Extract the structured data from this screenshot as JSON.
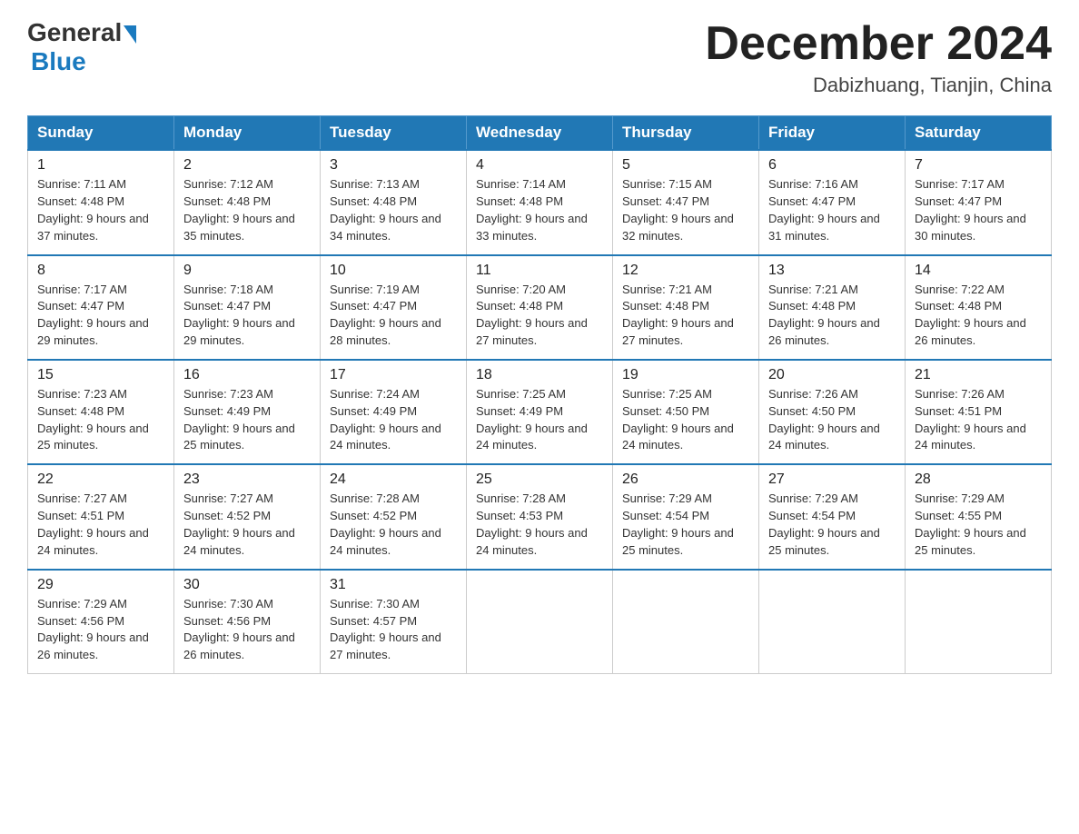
{
  "header": {
    "logo_general": "General",
    "logo_blue": "Blue",
    "month_title": "December 2024",
    "location": "Dabizhuang, Tianjin, China"
  },
  "weekdays": [
    "Sunday",
    "Monday",
    "Tuesday",
    "Wednesday",
    "Thursday",
    "Friday",
    "Saturday"
  ],
  "weeks": [
    [
      {
        "day": "1",
        "sunrise": "Sunrise: 7:11 AM",
        "sunset": "Sunset: 4:48 PM",
        "daylight": "Daylight: 9 hours and 37 minutes."
      },
      {
        "day": "2",
        "sunrise": "Sunrise: 7:12 AM",
        "sunset": "Sunset: 4:48 PM",
        "daylight": "Daylight: 9 hours and 35 minutes."
      },
      {
        "day": "3",
        "sunrise": "Sunrise: 7:13 AM",
        "sunset": "Sunset: 4:48 PM",
        "daylight": "Daylight: 9 hours and 34 minutes."
      },
      {
        "day": "4",
        "sunrise": "Sunrise: 7:14 AM",
        "sunset": "Sunset: 4:48 PM",
        "daylight": "Daylight: 9 hours and 33 minutes."
      },
      {
        "day": "5",
        "sunrise": "Sunrise: 7:15 AM",
        "sunset": "Sunset: 4:47 PM",
        "daylight": "Daylight: 9 hours and 32 minutes."
      },
      {
        "day": "6",
        "sunrise": "Sunrise: 7:16 AM",
        "sunset": "Sunset: 4:47 PM",
        "daylight": "Daylight: 9 hours and 31 minutes."
      },
      {
        "day": "7",
        "sunrise": "Sunrise: 7:17 AM",
        "sunset": "Sunset: 4:47 PM",
        "daylight": "Daylight: 9 hours and 30 minutes."
      }
    ],
    [
      {
        "day": "8",
        "sunrise": "Sunrise: 7:17 AM",
        "sunset": "Sunset: 4:47 PM",
        "daylight": "Daylight: 9 hours and 29 minutes."
      },
      {
        "day": "9",
        "sunrise": "Sunrise: 7:18 AM",
        "sunset": "Sunset: 4:47 PM",
        "daylight": "Daylight: 9 hours and 29 minutes."
      },
      {
        "day": "10",
        "sunrise": "Sunrise: 7:19 AM",
        "sunset": "Sunset: 4:47 PM",
        "daylight": "Daylight: 9 hours and 28 minutes."
      },
      {
        "day": "11",
        "sunrise": "Sunrise: 7:20 AM",
        "sunset": "Sunset: 4:48 PM",
        "daylight": "Daylight: 9 hours and 27 minutes."
      },
      {
        "day": "12",
        "sunrise": "Sunrise: 7:21 AM",
        "sunset": "Sunset: 4:48 PM",
        "daylight": "Daylight: 9 hours and 27 minutes."
      },
      {
        "day": "13",
        "sunrise": "Sunrise: 7:21 AM",
        "sunset": "Sunset: 4:48 PM",
        "daylight": "Daylight: 9 hours and 26 minutes."
      },
      {
        "day": "14",
        "sunrise": "Sunrise: 7:22 AM",
        "sunset": "Sunset: 4:48 PM",
        "daylight": "Daylight: 9 hours and 26 minutes."
      }
    ],
    [
      {
        "day": "15",
        "sunrise": "Sunrise: 7:23 AM",
        "sunset": "Sunset: 4:48 PM",
        "daylight": "Daylight: 9 hours and 25 minutes."
      },
      {
        "day": "16",
        "sunrise": "Sunrise: 7:23 AM",
        "sunset": "Sunset: 4:49 PM",
        "daylight": "Daylight: 9 hours and 25 minutes."
      },
      {
        "day": "17",
        "sunrise": "Sunrise: 7:24 AM",
        "sunset": "Sunset: 4:49 PM",
        "daylight": "Daylight: 9 hours and 24 minutes."
      },
      {
        "day": "18",
        "sunrise": "Sunrise: 7:25 AM",
        "sunset": "Sunset: 4:49 PM",
        "daylight": "Daylight: 9 hours and 24 minutes."
      },
      {
        "day": "19",
        "sunrise": "Sunrise: 7:25 AM",
        "sunset": "Sunset: 4:50 PM",
        "daylight": "Daylight: 9 hours and 24 minutes."
      },
      {
        "day": "20",
        "sunrise": "Sunrise: 7:26 AM",
        "sunset": "Sunset: 4:50 PM",
        "daylight": "Daylight: 9 hours and 24 minutes."
      },
      {
        "day": "21",
        "sunrise": "Sunrise: 7:26 AM",
        "sunset": "Sunset: 4:51 PM",
        "daylight": "Daylight: 9 hours and 24 minutes."
      }
    ],
    [
      {
        "day": "22",
        "sunrise": "Sunrise: 7:27 AM",
        "sunset": "Sunset: 4:51 PM",
        "daylight": "Daylight: 9 hours and 24 minutes."
      },
      {
        "day": "23",
        "sunrise": "Sunrise: 7:27 AM",
        "sunset": "Sunset: 4:52 PM",
        "daylight": "Daylight: 9 hours and 24 minutes."
      },
      {
        "day": "24",
        "sunrise": "Sunrise: 7:28 AM",
        "sunset": "Sunset: 4:52 PM",
        "daylight": "Daylight: 9 hours and 24 minutes."
      },
      {
        "day": "25",
        "sunrise": "Sunrise: 7:28 AM",
        "sunset": "Sunset: 4:53 PM",
        "daylight": "Daylight: 9 hours and 24 minutes."
      },
      {
        "day": "26",
        "sunrise": "Sunrise: 7:29 AM",
        "sunset": "Sunset: 4:54 PM",
        "daylight": "Daylight: 9 hours and 25 minutes."
      },
      {
        "day": "27",
        "sunrise": "Sunrise: 7:29 AM",
        "sunset": "Sunset: 4:54 PM",
        "daylight": "Daylight: 9 hours and 25 minutes."
      },
      {
        "day": "28",
        "sunrise": "Sunrise: 7:29 AM",
        "sunset": "Sunset: 4:55 PM",
        "daylight": "Daylight: 9 hours and 25 minutes."
      }
    ],
    [
      {
        "day": "29",
        "sunrise": "Sunrise: 7:29 AM",
        "sunset": "Sunset: 4:56 PM",
        "daylight": "Daylight: 9 hours and 26 minutes."
      },
      {
        "day": "30",
        "sunrise": "Sunrise: 7:30 AM",
        "sunset": "Sunset: 4:56 PM",
        "daylight": "Daylight: 9 hours and 26 minutes."
      },
      {
        "day": "31",
        "sunrise": "Sunrise: 7:30 AM",
        "sunset": "Sunset: 4:57 PM",
        "daylight": "Daylight: 9 hours and 27 minutes."
      },
      null,
      null,
      null,
      null
    ]
  ]
}
